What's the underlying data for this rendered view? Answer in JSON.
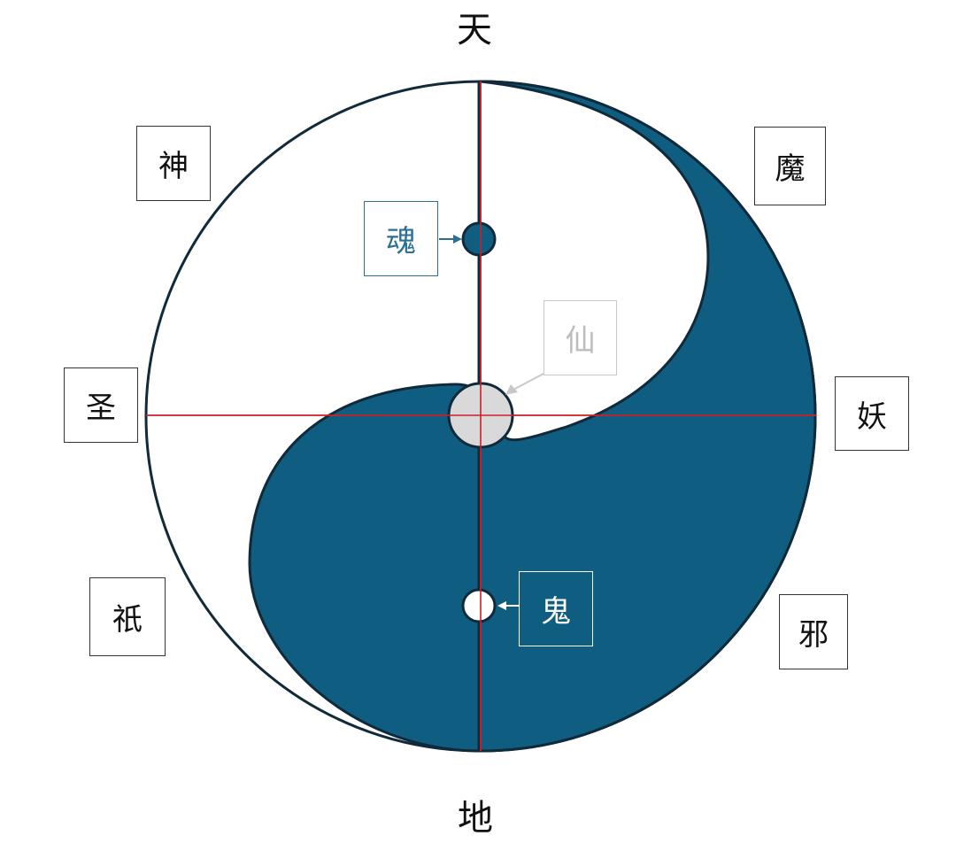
{
  "axis": {
    "top": "天",
    "bottom": "地"
  },
  "outer_labels": {
    "upper_left": "神",
    "upper_right": "魔",
    "left": "圣",
    "right": "妖",
    "lower_left": "祇",
    "lower_right": "邪"
  },
  "callouts": {
    "hun": "魂",
    "xian": "仙",
    "gui": "鬼"
  },
  "colors": {
    "yin": "#0f5e82",
    "outline": "#102a3a",
    "axis_line": "#cc1f2a",
    "center_circle": "#d9d9d9",
    "xian_box": "#c8c8c8",
    "hun_box": "#2a6f94"
  }
}
